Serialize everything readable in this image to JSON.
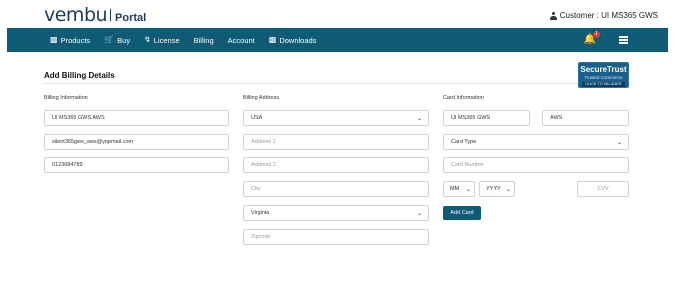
{
  "header": {
    "logo_word": "vembu",
    "logo_portal": "Portal",
    "customer_label": "Customer : UI MS365 GWS"
  },
  "nav": {
    "items": [
      {
        "label": "Products",
        "icon": "cubes-icon"
      },
      {
        "label": "Buy",
        "icon": "cart-icon"
      },
      {
        "label": "License",
        "icon": "key-icon"
      },
      {
        "label": "Billing",
        "icon": ""
      },
      {
        "label": "Account",
        "icon": ""
      },
      {
        "label": "Downloads",
        "icon": "cubes-icon"
      }
    ],
    "notification_count": "1"
  },
  "page": {
    "title": "Add Billing Details"
  },
  "trust_badge": {
    "line1": "SecureTrust",
    "line2": "Trusted Commerce",
    "line3": "CLICK TO VALIDATE"
  },
  "billing_information": {
    "label": "Billing Information",
    "name": "UI MS365 GWS AWS",
    "email": "silent365gws_aws@yopmail.com",
    "phone": "0123684789"
  },
  "billing_address": {
    "label": "Billing Address",
    "country": "USA",
    "address1_placeholder": "Address 1",
    "address2_placeholder": "Address 2",
    "city_placeholder": "City",
    "state": "Virginia",
    "zipcode_placeholder": "Zipcode"
  },
  "card_information": {
    "label": "Card Information",
    "first_name": "UI MS365 GWS",
    "last_name": "AWS",
    "card_type_placeholder": "Card Type",
    "card_number_placeholder": "Card Number",
    "month_placeholder": "MM",
    "year_placeholder": "YYYY",
    "cvv_placeholder": "CVV",
    "add_card_label": "Add Card"
  }
}
